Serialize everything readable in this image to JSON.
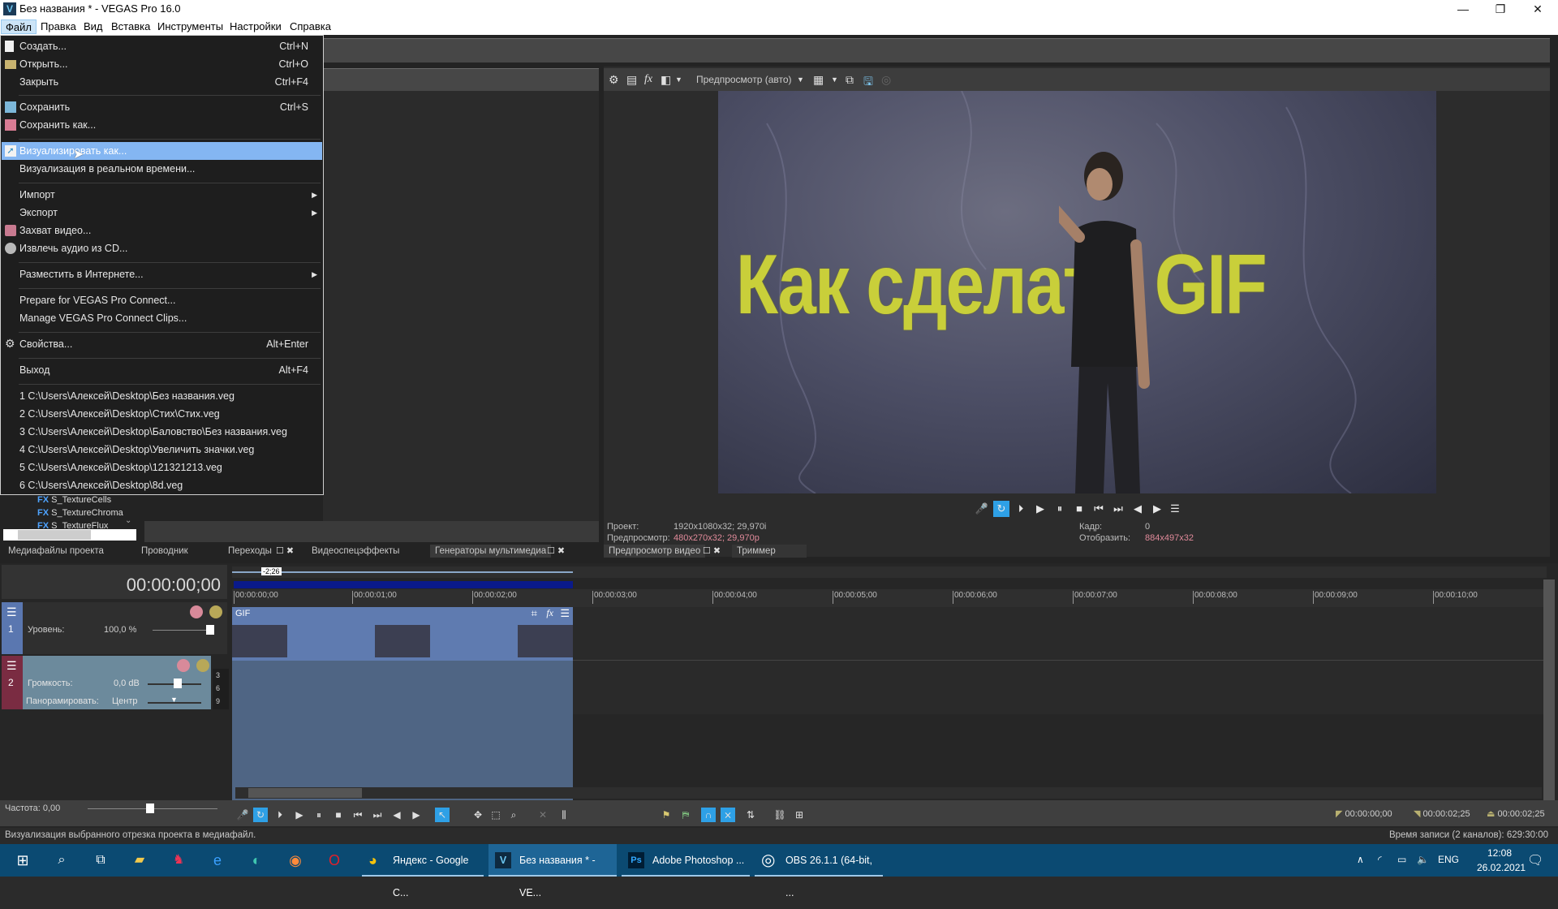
{
  "window": {
    "title": "Без названия * - VEGAS Pro 16.0",
    "app_icon": "V",
    "controls": {
      "minimize": "—",
      "maximize": "❐",
      "close": "✕"
    }
  },
  "menubar": {
    "items": [
      "Файл",
      "Правка",
      "Вид",
      "Вставка",
      "Инструменты",
      "Настройки",
      "Справка"
    ],
    "active": "Файл"
  },
  "file_menu": {
    "items": [
      {
        "label": "Создать...",
        "shortcut": "Ctrl+N",
        "icon": "new-file-icon"
      },
      {
        "label": "Открыть...",
        "shortcut": "Ctrl+O",
        "icon": "folder-icon"
      },
      {
        "label": "Закрыть",
        "shortcut": "Ctrl+F4"
      },
      {
        "label": "Сохранить",
        "shortcut": "Ctrl+S",
        "icon": "save-icon"
      },
      {
        "label": "Сохранить как...",
        "icon": "save-as-icon"
      },
      {
        "label": "Визуализировать как...",
        "icon": "render-icon",
        "highlighted": true
      },
      {
        "label": "Визуализация в реальном времени..."
      },
      {
        "label": "Импорт",
        "submenu": true
      },
      {
        "label": "Экспорт",
        "submenu": true
      },
      {
        "label": "Захват видео...",
        "icon": "capture-video-icon"
      },
      {
        "label": "Извлечь аудио из CD...",
        "icon": "extract-cd-icon"
      },
      {
        "label": "Разместить в Интернете...",
        "submenu": true
      },
      {
        "label": "Prepare for VEGAS Pro Connect..."
      },
      {
        "label": "Manage VEGAS Pro Connect Clips..."
      },
      {
        "label": "Свойства...",
        "shortcut": "Alt+Enter",
        "icon": "gear-icon"
      },
      {
        "label": "Выход",
        "shortcut": "Alt+F4"
      },
      {
        "label": "1 C:\\Users\\Алексей\\Desktop\\Без названия.veg"
      },
      {
        "label": "2 C:\\Users\\Алексей\\Desktop\\Стих\\Стих.veg"
      },
      {
        "label": "3 C:\\Users\\Алексей\\Desktop\\Баловство\\Без названия.veg"
      },
      {
        "label": "4 C:\\Users\\Алексей\\Desktop\\Увеличить значки.veg"
      },
      {
        "label": "5 C:\\Users\\Алексей\\Desktop\\121321213.veg"
      },
      {
        "label": "6 C:\\Users\\Алексей\\Desktop\\8d.veg"
      }
    ],
    "submenu_arrow": "▶"
  },
  "media_generators": {
    "tree_items": [
      "S_TextureCells",
      "S_TextureChroma",
      "S_TextureFlux"
    ],
    "fx_badge": "FX"
  },
  "dock_tabs": {
    "left": [
      "Медиафайлы проекта",
      "Проводник",
      "Переходы",
      "Видеоспецэффекты",
      "Генераторы мультимедиа"
    ],
    "right": [
      "Предпросмотр видео",
      "Триммер"
    ]
  },
  "preview": {
    "quality": "Предпросмотр (авто)",
    "video_overlay_text": "Как сделать GIF",
    "project_label": "Проект:",
    "project_value": "1920x1080x32; 29,970i",
    "preview_label": "Предпросмотр:",
    "preview_value": "480x270x32; 29,970p",
    "frame_label": "Кадр:",
    "frame_value": "0",
    "display_label": "Отобразить:",
    "display_value": "884x497x32"
  },
  "timeline": {
    "timecode": "00:00:00;00",
    "loop_length": "-2;26",
    "ruler": [
      "00:00:00;00",
      "00:00:01;00",
      "00:00:02;00",
      "00:00:03;00",
      "00:00:04;00",
      "00:00:05;00",
      "00:00:06;00",
      "00:00:07;00",
      "00:00:08;00",
      "00:00:09;00",
      "00:00:10;00"
    ],
    "video_track": {
      "number": "1",
      "level_label": "Уровень:",
      "level_value": "100,0 %",
      "clip_name": "GIF"
    },
    "audio_track": {
      "number": "2",
      "volume_label": "Громкость:",
      "volume_value": "0,0 dB",
      "pan_label": "Панорамировать:",
      "pan_value": "Центр",
      "meter_ticks": [
        "3",
        "6",
        "9"
      ]
    },
    "rate_label": "Частота: 0,00",
    "selection_start": "00:00:00;00",
    "selection_end": "00:00:02;25",
    "selection_length": "00:00:02;25"
  },
  "status": {
    "message": "Визуализация выбранного отрезка проекта в медиафайл.",
    "record_time": "Время записи (2 каналов): 629:30:00"
  },
  "taskbar": {
    "apps": [
      {
        "label": "Яндекс - Google C...",
        "icon": "chrome-icon"
      },
      {
        "label": "Без названия * - VE...",
        "icon": "vegas-icon",
        "active": true
      },
      {
        "label": "Adobe Photoshop ...",
        "icon": "photoshop-icon"
      },
      {
        "label": "OBS 26.1.1 (64-bit, ...",
        "icon": "obs-icon"
      }
    ],
    "lang": "ENG",
    "time": "12:08",
    "date": "26.02.2021"
  }
}
